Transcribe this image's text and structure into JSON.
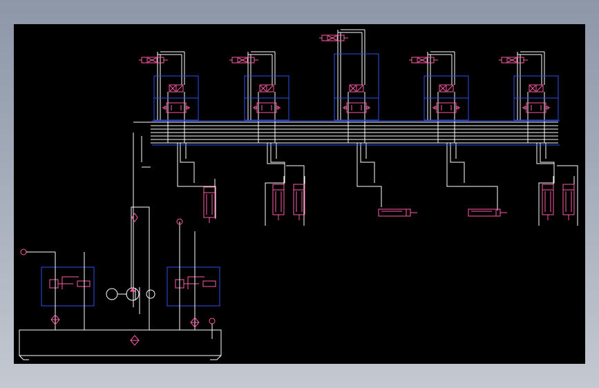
{
  "drawing": {
    "title": "",
    "background": "#000000",
    "frame_gradient": [
      "#8d97a8",
      "#c4c8d1"
    ],
    "colors": {
      "line": "#ffffff",
      "symbol": "#ff5ca8",
      "box": "#2f4ff0"
    }
  },
  "valve_stations": [
    {
      "id": "station-1",
      "actuator": "single-cylinder",
      "icon": "solenoid-valve-icon"
    },
    {
      "id": "station-2",
      "actuator": "double-cylinder",
      "icon": "solenoid-valve-icon"
    },
    {
      "id": "station-3",
      "actuator": "horizontal-cylinder",
      "icon": "solenoid-valve-icon"
    },
    {
      "id": "station-4",
      "actuator": "horizontal-cylinder",
      "icon": "solenoid-valve-icon"
    },
    {
      "id": "station-5",
      "actuator": "double-cylinder",
      "icon": "solenoid-valve-icon"
    }
  ],
  "power_unit": {
    "components": [
      "pump-icon",
      "motor-icon",
      "relief-valve-icon",
      "filter-icon",
      "pressure-gauge-icon",
      "oil-tank-icon"
    ]
  }
}
